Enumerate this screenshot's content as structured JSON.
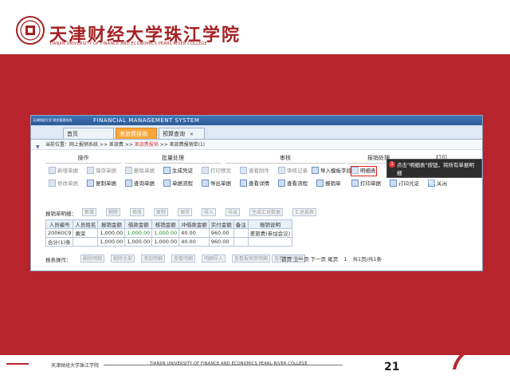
{
  "slide": {
    "logo_cn": "天津财经大学珠江学院",
    "logo_en": "TIANJIN UNIVERSITY OF FINANCE AND ECONOMICS PEARL RIVER COLLEGE",
    "footer_cn": "天津财经大学珠江学院",
    "footer_en": "TIANJIN UNIVERSITY OF FINANCE AND ECONOMICS PEARL RIVER COLLEGE",
    "page_number": "21",
    "accent_color": "#b8242b"
  },
  "app": {
    "title_cn": "天津财经大学 财务管理系统",
    "title_en": "FINANCIAL MANAGEMENT SYSTEM",
    "tabs": [
      {
        "label": "首页",
        "active": false
      },
      {
        "label": "差旅费报销",
        "active": true
      },
      {
        "label": "预算查询",
        "active": false
      }
    ],
    "breadcrumb": {
      "prefix": "当前位置：",
      "path": "网上报销系统 >> 差旅费 >> ",
      "link": "差旅费报销",
      "suffix": " >> 差旅费报销单(1)"
    },
    "sections": [
      "操作",
      "批量处理",
      "审核",
      "报销处理",
      "打印"
    ],
    "toolbar_row1": [
      {
        "label": "新增单据",
        "state": "off"
      },
      {
        "label": "保存单据",
        "state": "off"
      },
      {
        "label": "删除单据",
        "state": "off"
      },
      {
        "label": "生成凭证",
        "state": "on"
      },
      {
        "label": "打印预览",
        "state": "off"
      },
      {
        "label": "查看附件",
        "state": "off"
      },
      {
        "label": "审核记录",
        "state": "off"
      },
      {
        "label": "导入模板字段",
        "state": "on"
      },
      {
        "label": "明细表",
        "state": "highlight"
      },
      {
        "label": "附件",
        "state": "on"
      }
    ],
    "toolbar_row2": [
      {
        "label": "修改单据",
        "state": "off"
      },
      {
        "label": "复制单据",
        "state": "on"
      },
      {
        "label": "查询单据",
        "state": "on"
      },
      {
        "label": "单据流程",
        "state": "on"
      },
      {
        "label": "导出单据",
        "state": "on"
      },
      {
        "label": "查看详情",
        "state": "on"
      },
      {
        "label": "查看流程",
        "state": "on"
      },
      {
        "label": "报销单",
        "state": "on"
      },
      {
        "label": "打印单据",
        "state": "on"
      },
      {
        "label": "打印凭证",
        "state": "on"
      },
      {
        "label": "关闭",
        "state": "on"
      }
    ],
    "tooltip": {
      "num": "1",
      "line1": "点击\"明细表\"按钮，将所有单据明细",
      "line2": "填写后，即可提交给审批"
    },
    "list_label": "报销单明细：",
    "list_actions": [
      "新增",
      "删除",
      "修改",
      "复制",
      "保存",
      "导入",
      "导出",
      "生成汇总数据",
      "汇总报表"
    ],
    "grid": {
      "headers": [
        "人员编号",
        "人员姓名",
        "报销金额",
        "借款金额",
        "核销金额",
        "冲借款金额",
        "实付金额",
        "备注",
        "报销说明"
      ],
      "rows": [
        [
          "20060C9",
          "黄荣",
          "1,000.00",
          "1,000.00",
          "1,000.00",
          "40.00",
          "960.00",
          "",
          "差旅费(参加会议)"
        ],
        [
          "合计(1)条",
          "",
          "1,000.00",
          "1,000.00",
          "1,000.00",
          "40.00",
          "960.00",
          "",
          ""
        ]
      ]
    },
    "bottom_label": "报表操作：",
    "bottom_actions": [
      "删除明细",
      "删除全部",
      "添加明细",
      "查看明细",
      "明细导入",
      "查看报销单明细",
      "查看附件明细"
    ],
    "pager": {
      "text": "首页 上一页 下一页 尾页",
      "page": "1",
      "total": "共1页/共1条"
    }
  }
}
